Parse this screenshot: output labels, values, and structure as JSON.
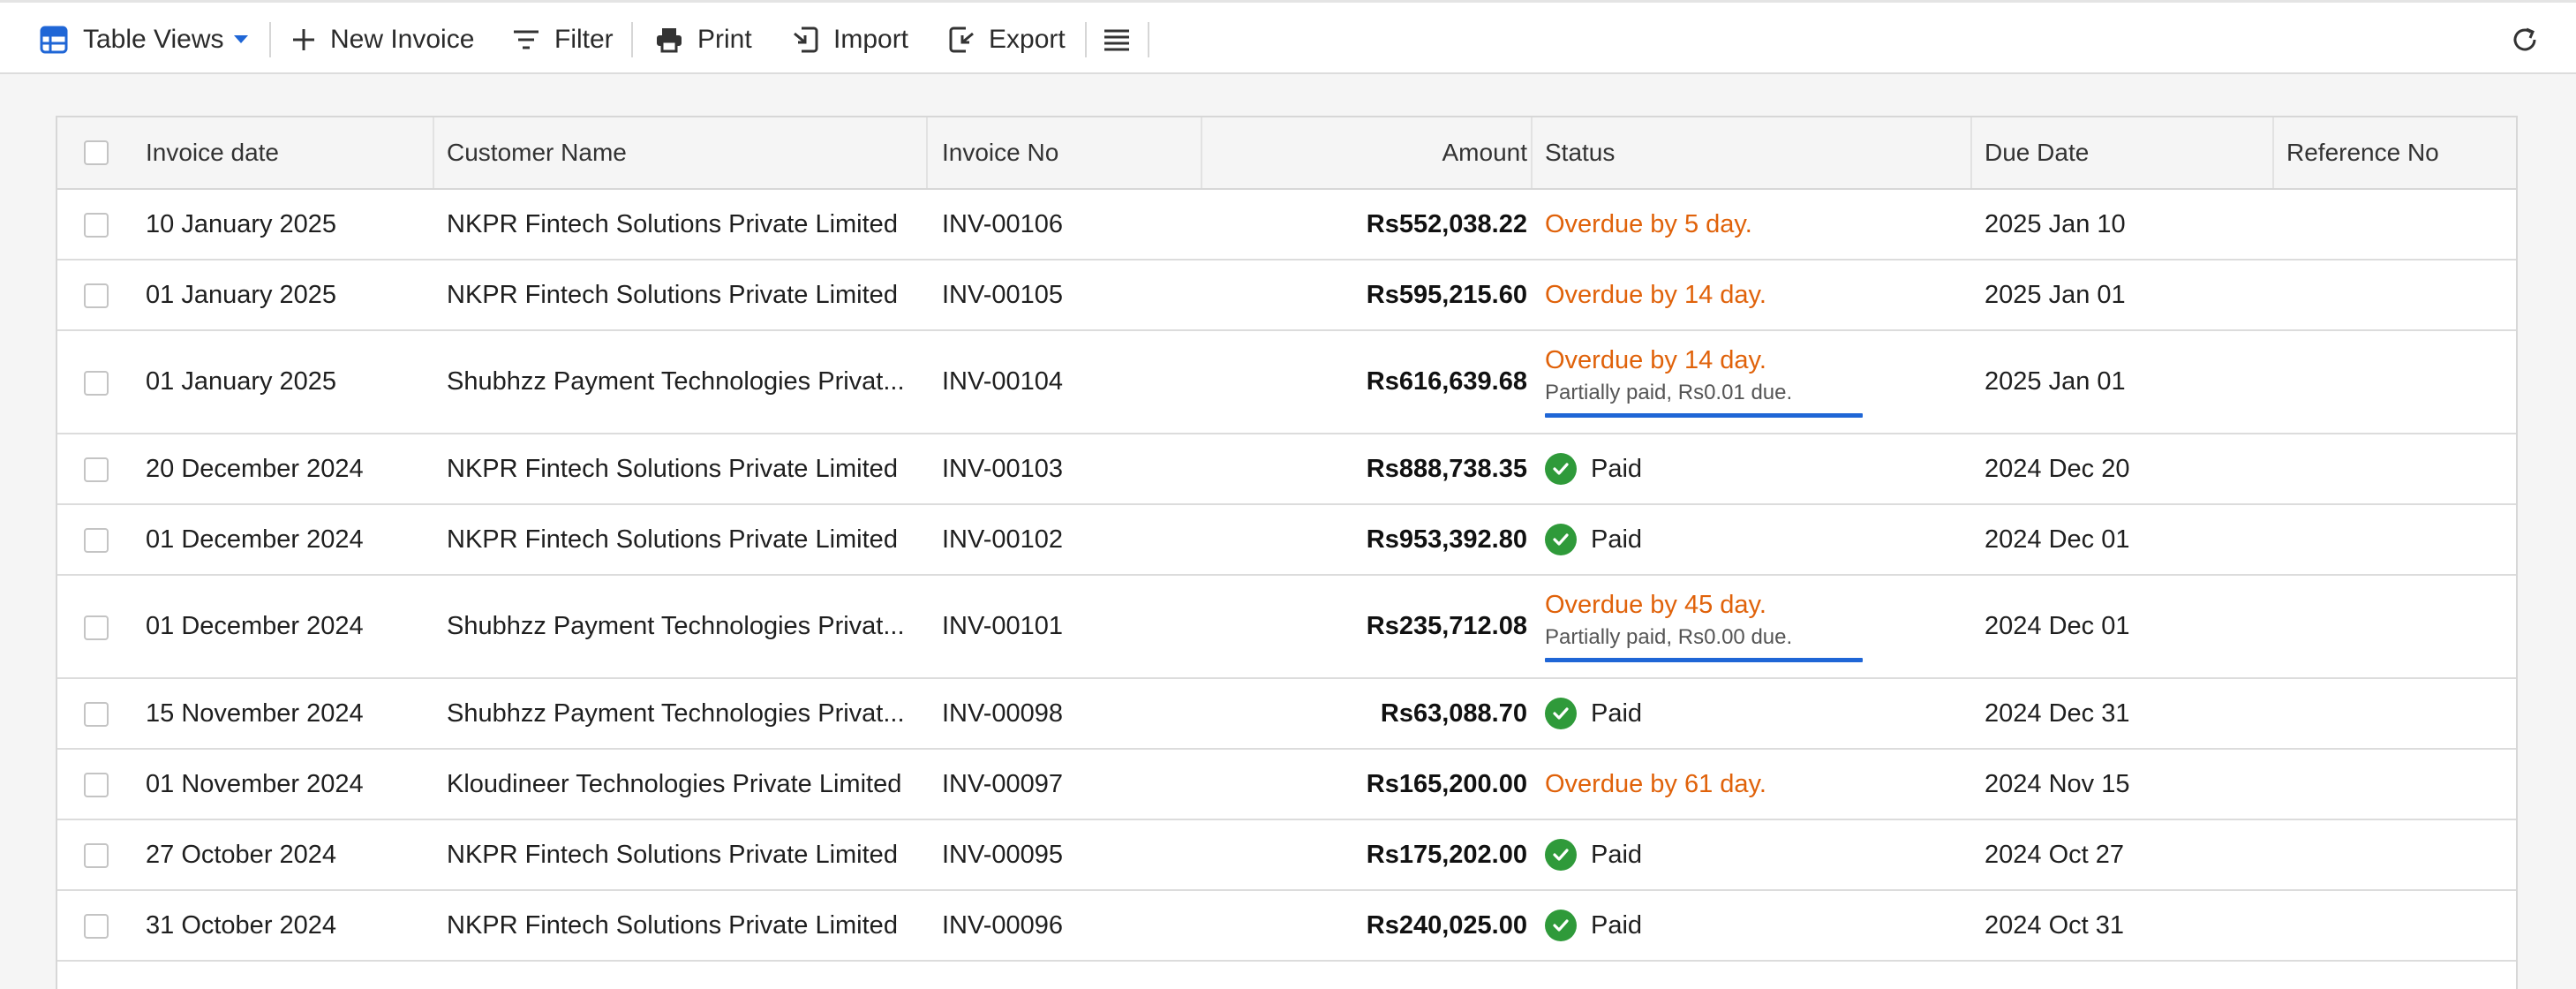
{
  "toolbar": {
    "table_views": "Table Views",
    "new_invoice": "New Invoice",
    "filter": "Filter",
    "print": "Print",
    "import": "Import",
    "export": "Export"
  },
  "colors": {
    "accent": "#1f66d6",
    "overdue": "#e0620a",
    "paid": "#2f9a3a"
  },
  "table": {
    "headers": {
      "invoice_date": "Invoice date",
      "customer_name": "Customer Name",
      "invoice_no": "Invoice No",
      "amount": "Amount",
      "status": "Status",
      "due_date": "Due Date",
      "reference_no": "Reference No"
    },
    "rows": [
      {
        "date": "10 January 2025",
        "customer": "NKPR Fintech Solutions Private Limited",
        "invoice": "INV-00106",
        "amount": "Rs552,038.22",
        "status_type": "overdue",
        "status": "Overdue by 5 day.",
        "partial": "",
        "partial_fraction": null,
        "due": "2025 Jan 10",
        "reference": ""
      },
      {
        "date": "01 January 2025",
        "customer": "NKPR Fintech Solutions Private Limited",
        "invoice": "INV-00105",
        "amount": "Rs595,215.60",
        "status_type": "overdue",
        "status": "Overdue by 14 day.",
        "partial": "",
        "partial_fraction": null,
        "due": "2025 Jan 01",
        "reference": ""
      },
      {
        "date": "01 January 2025",
        "customer": "Shubhzz Payment Technologies Privat...",
        "invoice": "INV-00104",
        "amount": "Rs616,639.68",
        "status_type": "overdue",
        "status": "Overdue by 14 day.",
        "partial": "Partially paid, Rs0.01 due.",
        "partial_fraction": 1.0,
        "due": "2025 Jan 01",
        "reference": ""
      },
      {
        "date": "20 December 2024",
        "customer": "NKPR Fintech Solutions Private Limited",
        "invoice": "INV-00103",
        "amount": "Rs888,738.35",
        "status_type": "paid",
        "status": "Paid",
        "partial": "",
        "partial_fraction": null,
        "due": "2024 Dec 20",
        "reference": ""
      },
      {
        "date": "01 December 2024",
        "customer": "NKPR Fintech Solutions Private Limited",
        "invoice": "INV-00102",
        "amount": "Rs953,392.80",
        "status_type": "paid",
        "status": "Paid",
        "partial": "",
        "partial_fraction": null,
        "due": "2024 Dec 01",
        "reference": ""
      },
      {
        "date": "01 December 2024",
        "customer": "Shubhzz Payment Technologies Privat...",
        "invoice": "INV-00101",
        "amount": "Rs235,712.08",
        "status_type": "overdue",
        "status": "Overdue by 45 day.",
        "partial": "Partially paid, Rs0.00 due.",
        "partial_fraction": 1.0,
        "due": "2024 Dec 01",
        "reference": ""
      },
      {
        "date": "15 November 2024",
        "customer": "Shubhzz Payment Technologies Privat...",
        "invoice": "INV-00098",
        "amount": "Rs63,088.70",
        "status_type": "paid",
        "status": "Paid",
        "partial": "",
        "partial_fraction": null,
        "due": "2024 Dec 31",
        "reference": ""
      },
      {
        "date": "01 November 2024",
        "customer": "Kloudineer Technologies Private Limited",
        "invoice": "INV-00097",
        "amount": "Rs165,200.00",
        "status_type": "overdue",
        "status": "Overdue by 61 day.",
        "partial": "",
        "partial_fraction": null,
        "due": "2024 Nov 15",
        "reference": ""
      },
      {
        "date": "27 October 2024",
        "customer": "NKPR Fintech Solutions Private Limited",
        "invoice": "INV-00095",
        "amount": "Rs175,202.00",
        "status_type": "paid",
        "status": "Paid",
        "partial": "",
        "partial_fraction": null,
        "due": "2024 Oct 27",
        "reference": ""
      },
      {
        "date": "31 October 2024",
        "customer": "NKPR Fintech Solutions Private Limited",
        "invoice": "INV-00096",
        "amount": "Rs240,025.00",
        "status_type": "paid",
        "status": "Paid",
        "partial": "",
        "partial_fraction": null,
        "due": "2024 Oct 31",
        "reference": ""
      }
    ]
  }
}
